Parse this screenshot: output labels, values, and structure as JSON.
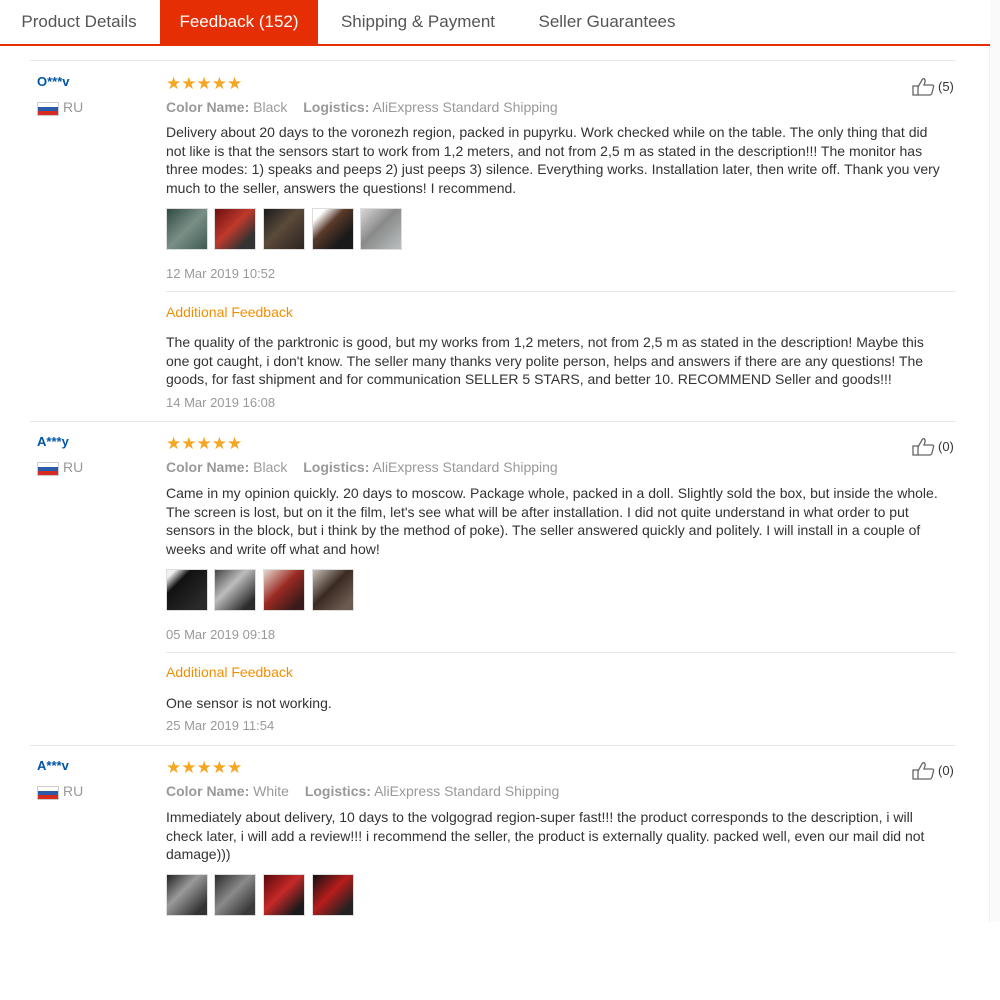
{
  "tabs": [
    {
      "label": "Product Details"
    },
    {
      "label": "Feedback (152)"
    },
    {
      "label": "Shipping & Payment"
    },
    {
      "label": "Seller Guarantees"
    }
  ],
  "reviews": [
    {
      "user": "O***v",
      "country": "RU",
      "stars": "★★★★★",
      "rating": 5,
      "color_label": "Color Name:",
      "color_value": "Black",
      "logistics_label": "Logistics:",
      "logistics_value": "AliExpress Standard Shipping",
      "likes": "(5)",
      "text": "Delivery about 20 days to the voronezh region, packed in pupyrku. Work checked while on the table. The only thing that did not like is that the sensors start to work from 1,2 meters, and not from 2,5 m as stated in the description!!! The monitor has three modes: 1) speaks and peeps 2) just peeps 3) silence. Everything works. Installation later, then write off. Thank you very much to the seller, answers the questions! I recommend.",
      "date": "12 Mar 2019 10:52",
      "additional_label": "Additional Feedback",
      "additional_text": "The quality of the parktronic is good, but my works from 1,2 meters, not from 2,5 m as stated in the description! Maybe this one got caught, i don't know. The seller many thanks very polite person, helps and answers if there are any questions! The goods, for fast shipment and for communication SELLER 5 STARS, and better 10. RECOMMEND Seller and goods!!!",
      "additional_date": "14 Mar 2019 16:08"
    },
    {
      "user": "A***y",
      "country": "RU",
      "stars": "★★★★★",
      "rating": 5,
      "color_label": "Color Name:",
      "color_value": "Black",
      "logistics_label": "Logistics:",
      "logistics_value": "AliExpress Standard Shipping",
      "likes": "(0)",
      "text": "Came in my opinion quickly. 20 days to moscow. Package whole, packed in a doll. Slightly sold the box, but inside the whole. The screen is lost, but on it the film, let's see what will be after installation. I did not quite understand in what order to put sensors in the block, but i think by the method of poke). The seller answered quickly and politely. I will install in a couple of weeks and write off what and how!",
      "date": "05 Mar 2019 09:18",
      "additional_label": "Additional Feedback",
      "additional_text": "One sensor is not working.",
      "additional_date": "25 Mar 2019 11:54"
    },
    {
      "user": "A***v",
      "country": "RU",
      "stars": "★★★★★",
      "rating": 5,
      "color_label": "Color Name:",
      "color_value": "White",
      "logistics_label": "Logistics:",
      "logistics_value": "AliExpress Standard Shipping",
      "likes": "(0)",
      "text": "Immediately about delivery, 10 days to the volgograd region-super fast!!! the product corresponds to the description, i will check later, i will add a review!!! i recommend the seller, the product is externally quality. packed well, even our mail did not damage)))"
    }
  ],
  "colors": {
    "accent": "#e62e04",
    "username": "#0055a5",
    "star": "#f5a623",
    "additional_feedback": "#f28f00",
    "muted": "#999999"
  },
  "icons": {
    "like": "thumbs-up-icon",
    "flag": "russia-flag-icon"
  }
}
